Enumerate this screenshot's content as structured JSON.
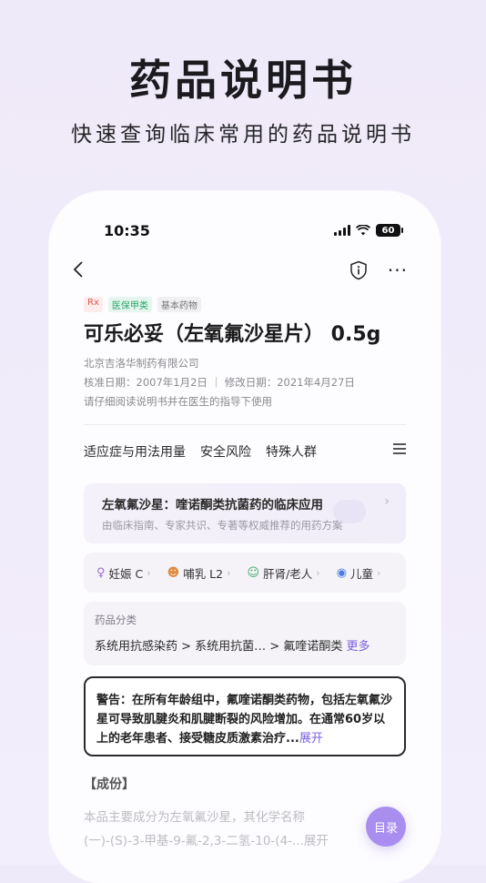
{
  "promo": {
    "title": "药品说明书",
    "subtitle": "快速查询临床常用的药品说明书"
  },
  "status_bar": {
    "time": "10:35",
    "battery": "60"
  },
  "nav": {
    "back_icon": "chevron-left-icon",
    "info_icon": "shield-info-icon",
    "more_icon": "more-horizontal-icon"
  },
  "drug": {
    "tags": [
      "Rx",
      "医保甲类",
      "基本药物"
    ],
    "name": "可乐必妥（左氧氟沙星片） 0.5g",
    "manufacturer": "北京吉洛华制药有限公司",
    "dates": "核准日期：2007年1月2日 ｜ 修改日期：2021年4月27日",
    "notice": "请仔细阅读说明书并在医生的指导下使用"
  },
  "tabs": [
    "适应症与用法用量",
    "安全风险",
    "特殊人群"
  ],
  "guide": {
    "title": "左氧氟沙星：喹诺酮类抗菌药的临床应用",
    "subtitle": "由临床指南、专家共识、专著等权威推荐的用药方案"
  },
  "populations": [
    {
      "icon": "pregnant-icon",
      "label": "妊娠 C"
    },
    {
      "icon": "lactation-icon",
      "label": "哺乳 L2"
    },
    {
      "icon": "liver-kidney-elderly-icon",
      "label": "肝肾/老人"
    },
    {
      "icon": "child-icon",
      "label": "儿童"
    }
  ],
  "category": {
    "label": "药品分类",
    "path": "系统用抗感染药 > 系统用抗菌… > 氟喹诺酮类",
    "more": "更多"
  },
  "warning": {
    "text": "警告：在所有年龄组中，氟喹诺酮类药物，包括左氧氟沙星可导致肌腱炎和肌腱断裂的风险增加。在通常60岁以上的老年患者、接受糖皮质激素治疗...",
    "expand": "展开"
  },
  "composition": {
    "heading": "【成份】",
    "line1": "本品主要成分为左氧氟沙星，其化学名称",
    "line2": "(一)-(S)-3-甲基-9-氟-2,3-二氢-10-(4-...展开"
  },
  "toc_button": "目录",
  "colors": {
    "accent": "#7b5fe0",
    "toc_bg": "#a98ef0",
    "background": "#efeaf9"
  }
}
